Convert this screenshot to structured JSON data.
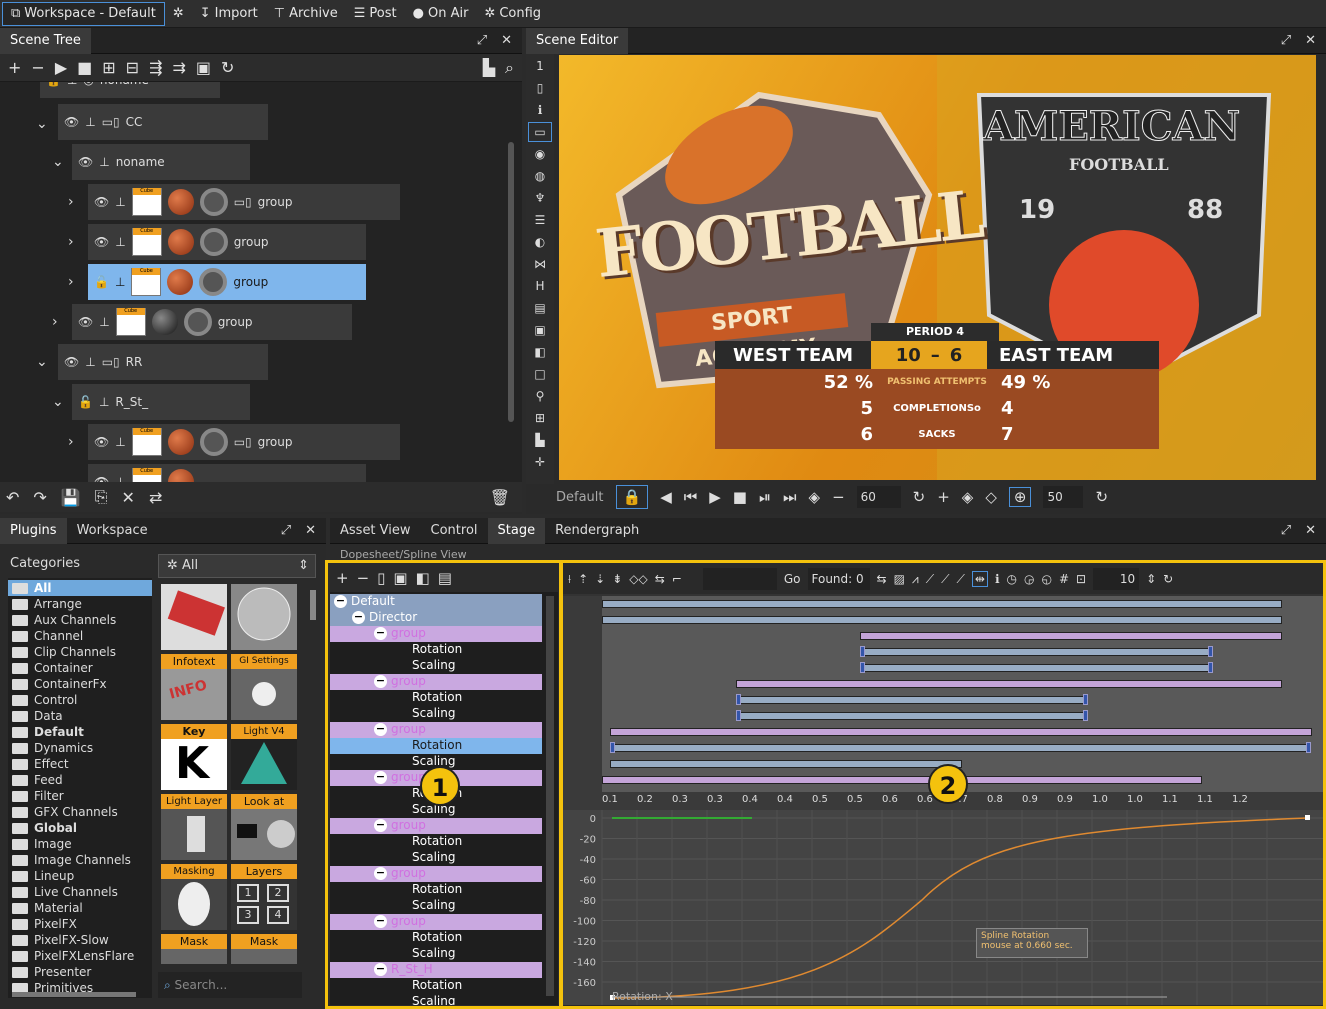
{
  "menubar": {
    "workspace": "Workspace - Default",
    "import": "Import",
    "archive": "Archive",
    "post": "Post",
    "onair": "On Air",
    "config": "Config"
  },
  "scene_tree": {
    "tab": "Scene Tree",
    "nodes": {
      "cc": "CC",
      "noname": "noname",
      "group": "group",
      "rr": "RR",
      "rst": "R_St_",
      "noname_top": "noname"
    }
  },
  "scene_editor": {
    "tab": "Scene Editor",
    "vtool_top": "1",
    "default": "Default",
    "frames": "60",
    "frames2": "50",
    "graphic": {
      "football": "FOOTBALL",
      "sport_academy": "SPORT ACADEMY",
      "american": "AMERICAN",
      "football2": "FOOTBALL",
      "year1": "19",
      "year2": "88"
    },
    "scoreboard": {
      "period": "PERIOD 4",
      "west": "WEST TEAM",
      "score_w": "10",
      "dash": "–",
      "score_e": "6",
      "east": "EAST TEAM",
      "rows": [
        {
          "l": "52 %",
          "m": "PASSING ATTEMPTS",
          "r": "49 %"
        },
        {
          "l": "5",
          "m": "COMPLETIONSo",
          "r": "4"
        },
        {
          "l": "6",
          "m": "SACKS",
          "r": "7"
        }
      ]
    }
  },
  "plugins": {
    "tabs": [
      "Plugins",
      "Workspace"
    ],
    "categories_label": "Categories",
    "filter": "All",
    "search": "Search...",
    "categories": [
      "All",
      "Arrange",
      "Aux Channels",
      "Channel",
      "Clip Channels",
      "Container",
      "ContainerFx",
      "Control",
      "Data",
      "Default",
      "Dynamics",
      "Effect",
      "Feed",
      "Filter",
      "GFX Channels",
      "Global",
      "Image",
      "Image Channels",
      "Lineup",
      "Live Channels",
      "Material",
      "PixelFX",
      "PixelFX-Slow",
      "PixelFXLensFlare",
      "Presenter",
      "Primitives"
    ],
    "tiles": [
      "Infotext",
      "GI Settings",
      "Key",
      "Light V4",
      "Light Layer",
      "Look at",
      "Masking",
      "Layers",
      "Mask",
      "Mask"
    ],
    "tile_glyphs": {
      "info": "INFO",
      "k": "K",
      "n1": "1",
      "n2": "2",
      "n3": "3",
      "n4": "4"
    }
  },
  "stage": {
    "tabs": [
      "Asset View",
      "Control",
      "Stage",
      "Rendergraph"
    ],
    "subtitle": "Dopesheet/Spline View",
    "tree": {
      "default": "Default",
      "director": "Director",
      "group": "group",
      "rotation": "Rotation",
      "scaling": "Scaling",
      "rst": "R_St_H"
    },
    "go": "Go",
    "found": "Found: 0",
    "step": "10",
    "ruler": [
      "0.1",
      "0.2",
      "0.3",
      "0.3",
      "0.4",
      "0.4",
      "0.5",
      "0.5",
      "0.6",
      "0.6",
      "0.7",
      "0.8",
      "0.9",
      "0.9",
      "1.0",
      "1.0",
      "1.1",
      "1.1",
      "1.2"
    ],
    "yaxis": [
      "0",
      "-20",
      "-40",
      "-60",
      "-80",
      "-100",
      "-120",
      "-140",
      "-160"
    ],
    "tooltip1": "Spline Rotation",
    "tooltip2": "mouse at 0.660 sec.",
    "curve_label": "Rotation: X"
  },
  "badges": {
    "b1": "1",
    "b2": "2"
  },
  "colors": {
    "accent": "#f4c20d",
    "selection": "#7fb6ec",
    "orange": "#f0a020"
  }
}
